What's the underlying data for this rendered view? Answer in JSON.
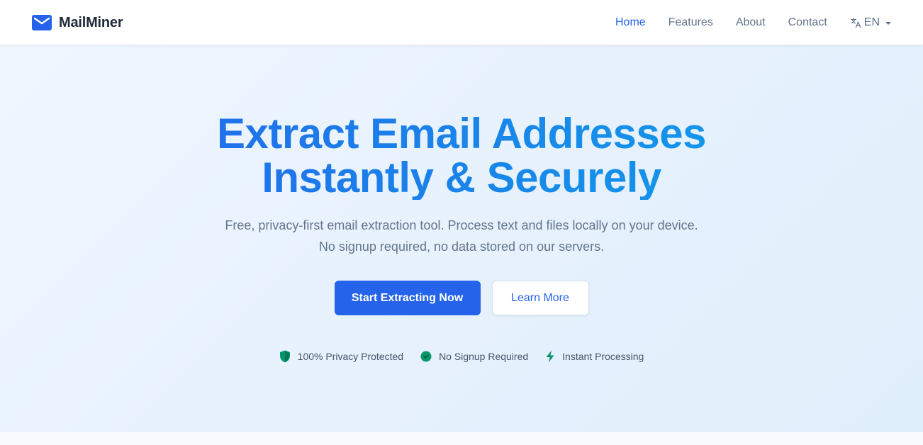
{
  "brand": {
    "name": "MailMiner",
    "icon": "mail-icon"
  },
  "nav": {
    "links": [
      {
        "label": "Home",
        "active": true
      },
      {
        "label": "Features",
        "active": false
      },
      {
        "label": "About",
        "active": false
      },
      {
        "label": "Contact",
        "active": false
      }
    ],
    "language": {
      "label": "EN",
      "icon": "translate-icon"
    }
  },
  "hero": {
    "title_line1": "Extract Email Addresses",
    "title_line2": "Instantly & Securely",
    "subtitle": "Free, privacy-first email extraction tool. Process text and files locally on your device. No signup required, no data stored on our servers.",
    "primary_button": "Start Extracting Now",
    "secondary_button": "Learn More",
    "badges": [
      {
        "label": "100% Privacy Protected",
        "icon": "shield-icon"
      },
      {
        "label": "No Signup Required",
        "icon": "check-circle-icon"
      },
      {
        "label": "Instant Processing",
        "icon": "bolt-icon"
      }
    ]
  },
  "colors": {
    "accent": "#2563eb",
    "gradient_end": "#0ea5e9",
    "badge_green": "#059669",
    "text_muted": "#64748b"
  }
}
